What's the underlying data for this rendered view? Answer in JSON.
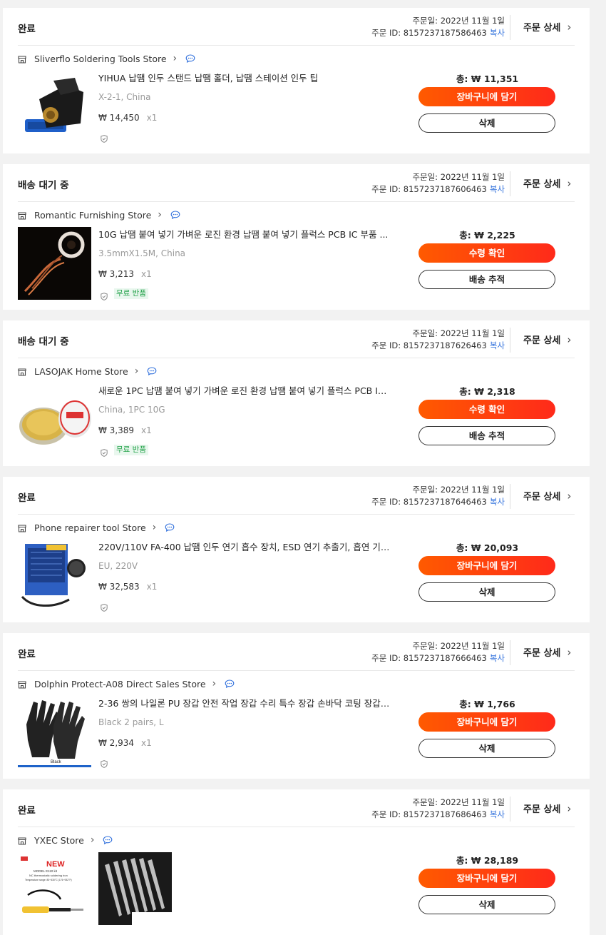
{
  "labels": {
    "order_date_prefix": "주문일: ",
    "order_id_prefix": "주문 ID: ",
    "copy": "복사",
    "order_detail": "주문 상세",
    "total_prefix": "총: ",
    "quantity_prefix": "x",
    "free_return": "무료 반품"
  },
  "colors": {
    "accent_gradient_start": "#ff5a00",
    "accent_gradient_end": "#ff2a1a",
    "link_blue": "#2f6fdc",
    "free_return_green": "#24a34a"
  },
  "orders": [
    {
      "status": "완료",
      "order_date": "2022년 11월 1일",
      "order_id": "8157237187586463",
      "store": "Sliverflo Soldering Tools Store",
      "product_name": "YIHUA 납땜 인두 스탠드 납땜 홀더, 납땜 스테이션 인두 팁",
      "variant": "X-2-1, China",
      "price": "₩ 14,450",
      "quantity": "1",
      "free_return": false,
      "total": "₩ 11,351",
      "primary_action": "장바구니에 담기",
      "secondary_action": "삭제",
      "thumbnail": "soldering-stand-image"
    },
    {
      "status": "배송 대기 중",
      "order_date": "2022년 11월 1일",
      "order_id": "8157237187606463",
      "store": "Romantic Furnishing Store",
      "product_name": "10G 납땜 붙여 넣기 가벼운 로진 환경 납땜 붙여 넣기 플럭스 PCB IC 부품 ...",
      "variant": "3.5mmX1.5M, China",
      "price": "₩ 3,213",
      "quantity": "1",
      "free_return": true,
      "total": "₩ 2,225",
      "primary_action": "수령 확인",
      "secondary_action": "배송 추적",
      "thumbnail": "desoldering-wick-image"
    },
    {
      "status": "배송 대기 중",
      "order_date": "2022년 11월 1일",
      "order_id": "8157237187626463",
      "store": "LASOJAK Home Store",
      "product_name": "새로운 1PC 납땜 붙여 넣기 가벼운 로진 환경 납땜 붙여 넣기 플럭스 PCB IC...",
      "variant": "China, 1PC 10G",
      "price": "₩ 3,389",
      "quantity": "1",
      "free_return": true,
      "total": "₩ 2,318",
      "primary_action": "수령 확인",
      "secondary_action": "배송 추적",
      "thumbnail": "rosin-tin-image"
    },
    {
      "status": "완료",
      "order_date": "2022년 11월 1일",
      "order_id": "8157237187646463",
      "store": "Phone repairer tool Store",
      "product_name": "220V/110V FA-400 납땜 인두 연기 흡수 장치, ESD 연기 추출기, 흡연 기기, ...",
      "variant": "EU, 220V",
      "price": "₩ 32,583",
      "quantity": "1",
      "free_return": false,
      "total": "₩ 20,093",
      "primary_action": "장바구니에 담기",
      "secondary_action": "삭제",
      "thumbnail": "fume-extractor-image"
    },
    {
      "status": "완료",
      "order_date": "2022년 11월 1일",
      "order_id": "8157237187666463",
      "store": "Dolphin Protect-A08 Direct Sales Store",
      "product_name": "2-36 쌍의 나일론 PU 장갑 안전 작업 장갑 수리 특수 장갑 손바닥 코팅 장갑 ...",
      "variant": "Black 2 pairs, L",
      "price": "₩ 2,934",
      "quantity": "1",
      "free_return": false,
      "total": "₩ 1,766",
      "primary_action": "장바구니에 담기",
      "secondary_action": "삭제",
      "thumbnail": "work-gloves-image"
    },
    {
      "status": "완료",
      "order_date": "2022년 11월 1일",
      "order_id": "8157237187686463",
      "store": "YXEC Store",
      "product_name": "",
      "variant": "",
      "price": "",
      "quantity": "",
      "free_return": false,
      "total": "₩ 28,189",
      "primary_action": "장바구니에 담기",
      "secondary_action": "삭제",
      "thumbnail": "soldering-iron-kit-image",
      "thumb_text": {
        "new": "NEW",
        "model": "MODEL E110 kit",
        "desc": "NC thermostatic soldering iron",
        "range": "Temperature range: 80~530°C (176~932°F)"
      }
    }
  ]
}
